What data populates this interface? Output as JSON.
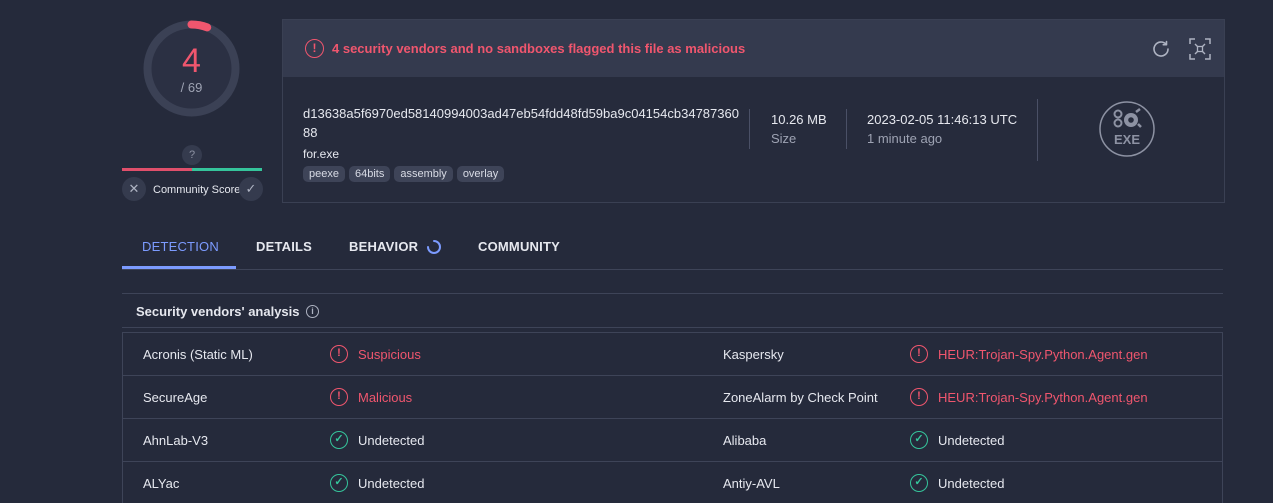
{
  "score": {
    "detections": "4",
    "total": "/ 69",
    "fraction": 0.058
  },
  "community": {
    "unknown_symbol": "?",
    "label": "Community Score",
    "negative_symbol": "✕",
    "positive_symbol": "✓"
  },
  "file": {
    "alert_text": "4 security vendors and no sandboxes flagged this file as malicious",
    "hash": "d13638a5f6970ed58140994003ad47eb54fdd48fd59ba9c04154cb3478736088",
    "name": "for.exe",
    "tags": [
      "peexe",
      "64bits",
      "assembly",
      "overlay"
    ],
    "size_value": "10.26 MB",
    "size_label": "Size",
    "date_value": "2023-02-05 11:46:13 UTC",
    "date_label": "1 minute ago",
    "type_icon_label": "EXE"
  },
  "tabs": [
    "DETECTION",
    "DETAILS",
    "BEHAVIOR",
    "COMMUNITY"
  ],
  "analysis": {
    "title": "Security vendors' analysis",
    "info_symbol": "i",
    "rows": [
      {
        "left": {
          "vendor": "Acronis (Static ML)",
          "result": "Suspicious",
          "status": "bad"
        },
        "right": {
          "vendor": "Kaspersky",
          "result": "HEUR:Trojan-Spy.Python.Agent.gen",
          "status": "bad"
        }
      },
      {
        "left": {
          "vendor": "SecureAge",
          "result": "Malicious",
          "status": "bad"
        },
        "right": {
          "vendor": "ZoneAlarm by Check Point",
          "result": "HEUR:Trojan-Spy.Python.Agent.gen",
          "status": "bad"
        }
      },
      {
        "left": {
          "vendor": "AhnLab-V3",
          "result": "Undetected",
          "status": "good"
        },
        "right": {
          "vendor": "Alibaba",
          "result": "Undetected",
          "status": "good"
        }
      },
      {
        "left": {
          "vendor": "ALYac",
          "result": "Undetected",
          "status": "good"
        },
        "right": {
          "vendor": "Antiy-AVL",
          "result": "Undetected",
          "status": "good"
        }
      }
    ]
  },
  "colors": {
    "malicious": "#f0566e",
    "clean": "#35c49b",
    "accent": "#7c9bff",
    "background": "#252a3b"
  }
}
